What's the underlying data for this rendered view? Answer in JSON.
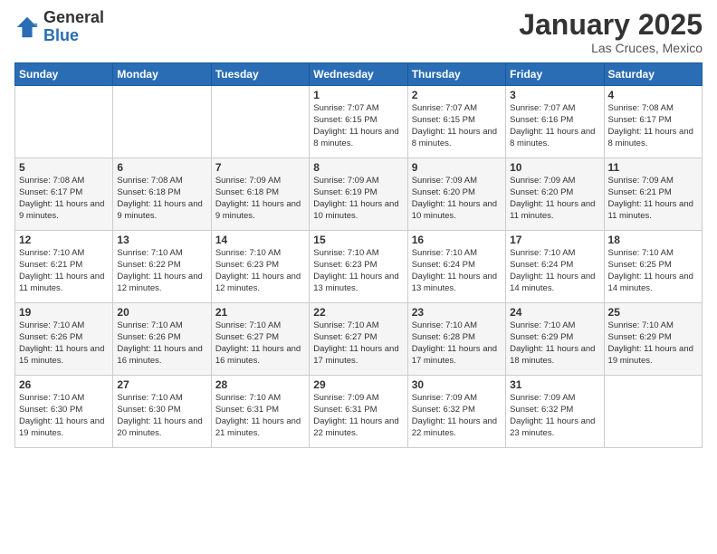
{
  "logo": {
    "general": "General",
    "blue": "Blue"
  },
  "title": {
    "month": "January 2025",
    "location": "Las Cruces, Mexico"
  },
  "weekdays": [
    "Sunday",
    "Monday",
    "Tuesday",
    "Wednesday",
    "Thursday",
    "Friday",
    "Saturday"
  ],
  "weeks": [
    [
      {
        "day": "",
        "sunrise": "",
        "sunset": "",
        "daylight": ""
      },
      {
        "day": "",
        "sunrise": "",
        "sunset": "",
        "daylight": ""
      },
      {
        "day": "",
        "sunrise": "",
        "sunset": "",
        "daylight": ""
      },
      {
        "day": "1",
        "sunrise": "Sunrise: 7:07 AM",
        "sunset": "Sunset: 6:15 PM",
        "daylight": "Daylight: 11 hours and 8 minutes."
      },
      {
        "day": "2",
        "sunrise": "Sunrise: 7:07 AM",
        "sunset": "Sunset: 6:15 PM",
        "daylight": "Daylight: 11 hours and 8 minutes."
      },
      {
        "day": "3",
        "sunrise": "Sunrise: 7:07 AM",
        "sunset": "Sunset: 6:16 PM",
        "daylight": "Daylight: 11 hours and 8 minutes."
      },
      {
        "day": "4",
        "sunrise": "Sunrise: 7:08 AM",
        "sunset": "Sunset: 6:17 PM",
        "daylight": "Daylight: 11 hours and 8 minutes."
      }
    ],
    [
      {
        "day": "5",
        "sunrise": "Sunrise: 7:08 AM",
        "sunset": "Sunset: 6:17 PM",
        "daylight": "Daylight: 11 hours and 9 minutes."
      },
      {
        "day": "6",
        "sunrise": "Sunrise: 7:08 AM",
        "sunset": "Sunset: 6:18 PM",
        "daylight": "Daylight: 11 hours and 9 minutes."
      },
      {
        "day": "7",
        "sunrise": "Sunrise: 7:09 AM",
        "sunset": "Sunset: 6:18 PM",
        "daylight": "Daylight: 11 hours and 9 minutes."
      },
      {
        "day": "8",
        "sunrise": "Sunrise: 7:09 AM",
        "sunset": "Sunset: 6:19 PM",
        "daylight": "Daylight: 11 hours and 10 minutes."
      },
      {
        "day": "9",
        "sunrise": "Sunrise: 7:09 AM",
        "sunset": "Sunset: 6:20 PM",
        "daylight": "Daylight: 11 hours and 10 minutes."
      },
      {
        "day": "10",
        "sunrise": "Sunrise: 7:09 AM",
        "sunset": "Sunset: 6:20 PM",
        "daylight": "Daylight: 11 hours and 11 minutes."
      },
      {
        "day": "11",
        "sunrise": "Sunrise: 7:09 AM",
        "sunset": "Sunset: 6:21 PM",
        "daylight": "Daylight: 11 hours and 11 minutes."
      }
    ],
    [
      {
        "day": "12",
        "sunrise": "Sunrise: 7:10 AM",
        "sunset": "Sunset: 6:21 PM",
        "daylight": "Daylight: 11 hours and 11 minutes."
      },
      {
        "day": "13",
        "sunrise": "Sunrise: 7:10 AM",
        "sunset": "Sunset: 6:22 PM",
        "daylight": "Daylight: 11 hours and 12 minutes."
      },
      {
        "day": "14",
        "sunrise": "Sunrise: 7:10 AM",
        "sunset": "Sunset: 6:23 PM",
        "daylight": "Daylight: 11 hours and 12 minutes."
      },
      {
        "day": "15",
        "sunrise": "Sunrise: 7:10 AM",
        "sunset": "Sunset: 6:23 PM",
        "daylight": "Daylight: 11 hours and 13 minutes."
      },
      {
        "day": "16",
        "sunrise": "Sunrise: 7:10 AM",
        "sunset": "Sunset: 6:24 PM",
        "daylight": "Daylight: 11 hours and 13 minutes."
      },
      {
        "day": "17",
        "sunrise": "Sunrise: 7:10 AM",
        "sunset": "Sunset: 6:24 PM",
        "daylight": "Daylight: 11 hours and 14 minutes."
      },
      {
        "day": "18",
        "sunrise": "Sunrise: 7:10 AM",
        "sunset": "Sunset: 6:25 PM",
        "daylight": "Daylight: 11 hours and 14 minutes."
      }
    ],
    [
      {
        "day": "19",
        "sunrise": "Sunrise: 7:10 AM",
        "sunset": "Sunset: 6:26 PM",
        "daylight": "Daylight: 11 hours and 15 minutes."
      },
      {
        "day": "20",
        "sunrise": "Sunrise: 7:10 AM",
        "sunset": "Sunset: 6:26 PM",
        "daylight": "Daylight: 11 hours and 16 minutes."
      },
      {
        "day": "21",
        "sunrise": "Sunrise: 7:10 AM",
        "sunset": "Sunset: 6:27 PM",
        "daylight": "Daylight: 11 hours and 16 minutes."
      },
      {
        "day": "22",
        "sunrise": "Sunrise: 7:10 AM",
        "sunset": "Sunset: 6:27 PM",
        "daylight": "Daylight: 11 hours and 17 minutes."
      },
      {
        "day": "23",
        "sunrise": "Sunrise: 7:10 AM",
        "sunset": "Sunset: 6:28 PM",
        "daylight": "Daylight: 11 hours and 17 minutes."
      },
      {
        "day": "24",
        "sunrise": "Sunrise: 7:10 AM",
        "sunset": "Sunset: 6:29 PM",
        "daylight": "Daylight: 11 hours and 18 minutes."
      },
      {
        "day": "25",
        "sunrise": "Sunrise: 7:10 AM",
        "sunset": "Sunset: 6:29 PM",
        "daylight": "Daylight: 11 hours and 19 minutes."
      }
    ],
    [
      {
        "day": "26",
        "sunrise": "Sunrise: 7:10 AM",
        "sunset": "Sunset: 6:30 PM",
        "daylight": "Daylight: 11 hours and 19 minutes."
      },
      {
        "day": "27",
        "sunrise": "Sunrise: 7:10 AM",
        "sunset": "Sunset: 6:30 PM",
        "daylight": "Daylight: 11 hours and 20 minutes."
      },
      {
        "day": "28",
        "sunrise": "Sunrise: 7:10 AM",
        "sunset": "Sunset: 6:31 PM",
        "daylight": "Daylight: 11 hours and 21 minutes."
      },
      {
        "day": "29",
        "sunrise": "Sunrise: 7:09 AM",
        "sunset": "Sunset: 6:31 PM",
        "daylight": "Daylight: 11 hours and 22 minutes."
      },
      {
        "day": "30",
        "sunrise": "Sunrise: 7:09 AM",
        "sunset": "Sunset: 6:32 PM",
        "daylight": "Daylight: 11 hours and 22 minutes."
      },
      {
        "day": "31",
        "sunrise": "Sunrise: 7:09 AM",
        "sunset": "Sunset: 6:32 PM",
        "daylight": "Daylight: 11 hours and 23 minutes."
      },
      {
        "day": "",
        "sunrise": "",
        "sunset": "",
        "daylight": ""
      }
    ]
  ]
}
